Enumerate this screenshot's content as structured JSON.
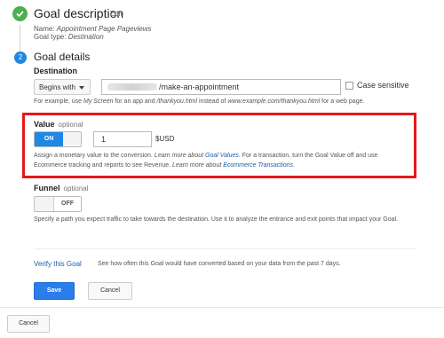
{
  "step1": {
    "title": "Goal description",
    "edit_label": "Edit",
    "name_prefix": "Name: ",
    "name_value": "Appointment Page Pageviews",
    "type_prefix": "Goal type: ",
    "type_value": "Destination",
    "status_icon": "check-icon",
    "status_color": "#4caf50"
  },
  "step2": {
    "number": "2",
    "title": "Goal details",
    "number_color": "#1e88e5"
  },
  "destination": {
    "label": "Destination",
    "match_type": "Begins with",
    "url_value": "/make-an-appointment",
    "case_sensitive_label": "Case sensitive",
    "case_sensitive_checked": false,
    "help": {
      "t1": "For example, use ",
      "t2": "My Screen",
      "t3": " for an app and ",
      "t4": "/thankyou.html",
      "t5": " instead of ",
      "t6": "www.example.com/thankyou.html",
      "t7": " for a web page."
    }
  },
  "value": {
    "label": "Value",
    "optional": "optional",
    "toggle_state": "ON",
    "amount": "1",
    "currency": "$USD",
    "help": {
      "t1": "Assign a monetary value to the conversion. ",
      "t2": "Learn more about ",
      "t3": "Goal Values",
      "t4": ". For a transaction, turn the Goal Value off and use Ecommerce tracking and reports to see Revenue. ",
      "t5": "Learn more about ",
      "t6": "Ecommerce Transactions",
      "t7": "."
    },
    "highlight_color": "#e5191a"
  },
  "funnel": {
    "label": "Funnel",
    "optional": "optional",
    "toggle_state": "OFF",
    "help": "Specify a path you expect traffic to take towards the destination. Use it to analyze the entrance and exit points that impact your Goal."
  },
  "verify": {
    "link": "Verify this Goal",
    "description": "See how often this Goal would have converted based on your data from the past 7 days."
  },
  "actions": {
    "save": "Save",
    "cancel": "Cancel",
    "accent": "#2b7de9"
  },
  "footer": {
    "cancel": "Cancel"
  }
}
